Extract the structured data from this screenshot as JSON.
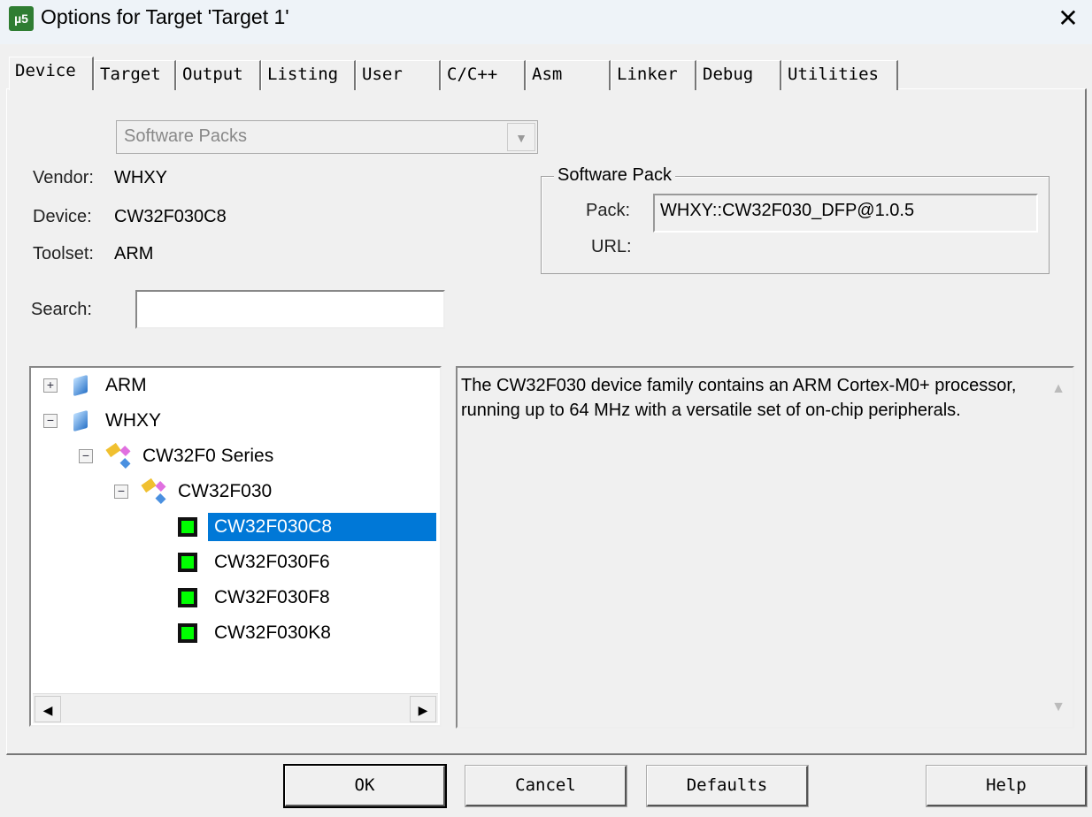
{
  "window": {
    "title": "Options for Target 'Target 1'",
    "icon": "uvision-icon"
  },
  "tabs": [
    "Device",
    "Target",
    "Output",
    "Listing",
    "User",
    "C/C++",
    "Asm",
    "Linker",
    "Debug",
    "Utilities"
  ],
  "device": {
    "source_select": "Software Packs",
    "vendor_label": "Vendor:",
    "vendor": "WHXY",
    "device_label": "Device:",
    "device": "CW32F030C8",
    "toolset_label": "Toolset:",
    "toolset": "ARM",
    "search_label": "Search:",
    "search_value": "",
    "pack_group": "Software Pack",
    "pack_label": "Pack:",
    "pack": "WHXY::CW32F030_DFP@1.0.5",
    "url_label": "URL:",
    "tree": {
      "arm": "ARM",
      "whxy": "WHXY",
      "series": "CW32F0 Series",
      "family": "CW32F030",
      "devices": [
        "CW32F030C8",
        "CW32F030F6",
        "CW32F030F8",
        "CW32F030K8"
      ],
      "selected": "CW32F030C8"
    },
    "description": "The CW32F030 device family contains an ARM Cortex-M0+ processor, running up to 64 MHz with a versatile set of on-chip peripherals."
  },
  "buttons": {
    "ok": "OK",
    "cancel": "Cancel",
    "defaults": "Defaults",
    "help": "Help"
  }
}
